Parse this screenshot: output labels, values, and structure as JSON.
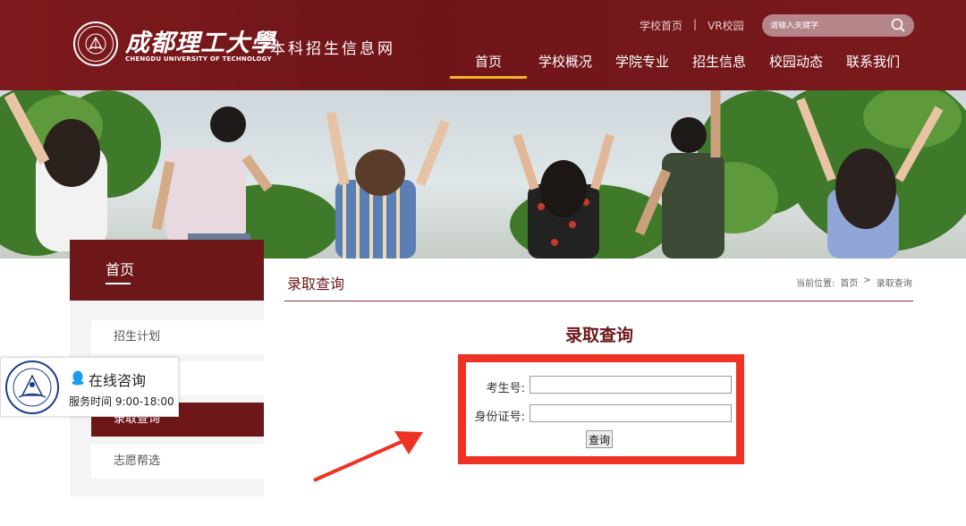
{
  "header": {
    "logo_cn": "成都理工大學",
    "logo_en": "CHENGDU UNIVERSITY OF TECHNOLOGY",
    "site_name": "本科招生信息网",
    "top_links": [
      "学校首页",
      "|",
      "VR校园"
    ],
    "search_placeholder": "请输入关键字",
    "nav": [
      "首页",
      "学校概况",
      "学院专业",
      "招生信息",
      "校园动态",
      "联系我们"
    ],
    "active_nav": "首页",
    "brand_color": "#6d1719",
    "accent_color": "#f0b429"
  },
  "sidebar": {
    "title": "首页",
    "items": [
      "招生计划",
      "",
      "录取查询",
      "志愿帮选"
    ],
    "active_item": "录取查询"
  },
  "consult": {
    "title": "在线咨询",
    "time": "服务时间 9:00-18:00"
  },
  "main": {
    "title": "录取查询",
    "breadcrumb": [
      "当前位置:",
      "首页",
      ">",
      "录取查询"
    ],
    "query_title": "录取查询",
    "form": {
      "exam_no_label": "考生号:",
      "exam_no_value": "",
      "id_label": "身份证号:",
      "id_value": "",
      "submit_label": "查询"
    },
    "highlight_color": "#ee3224"
  }
}
